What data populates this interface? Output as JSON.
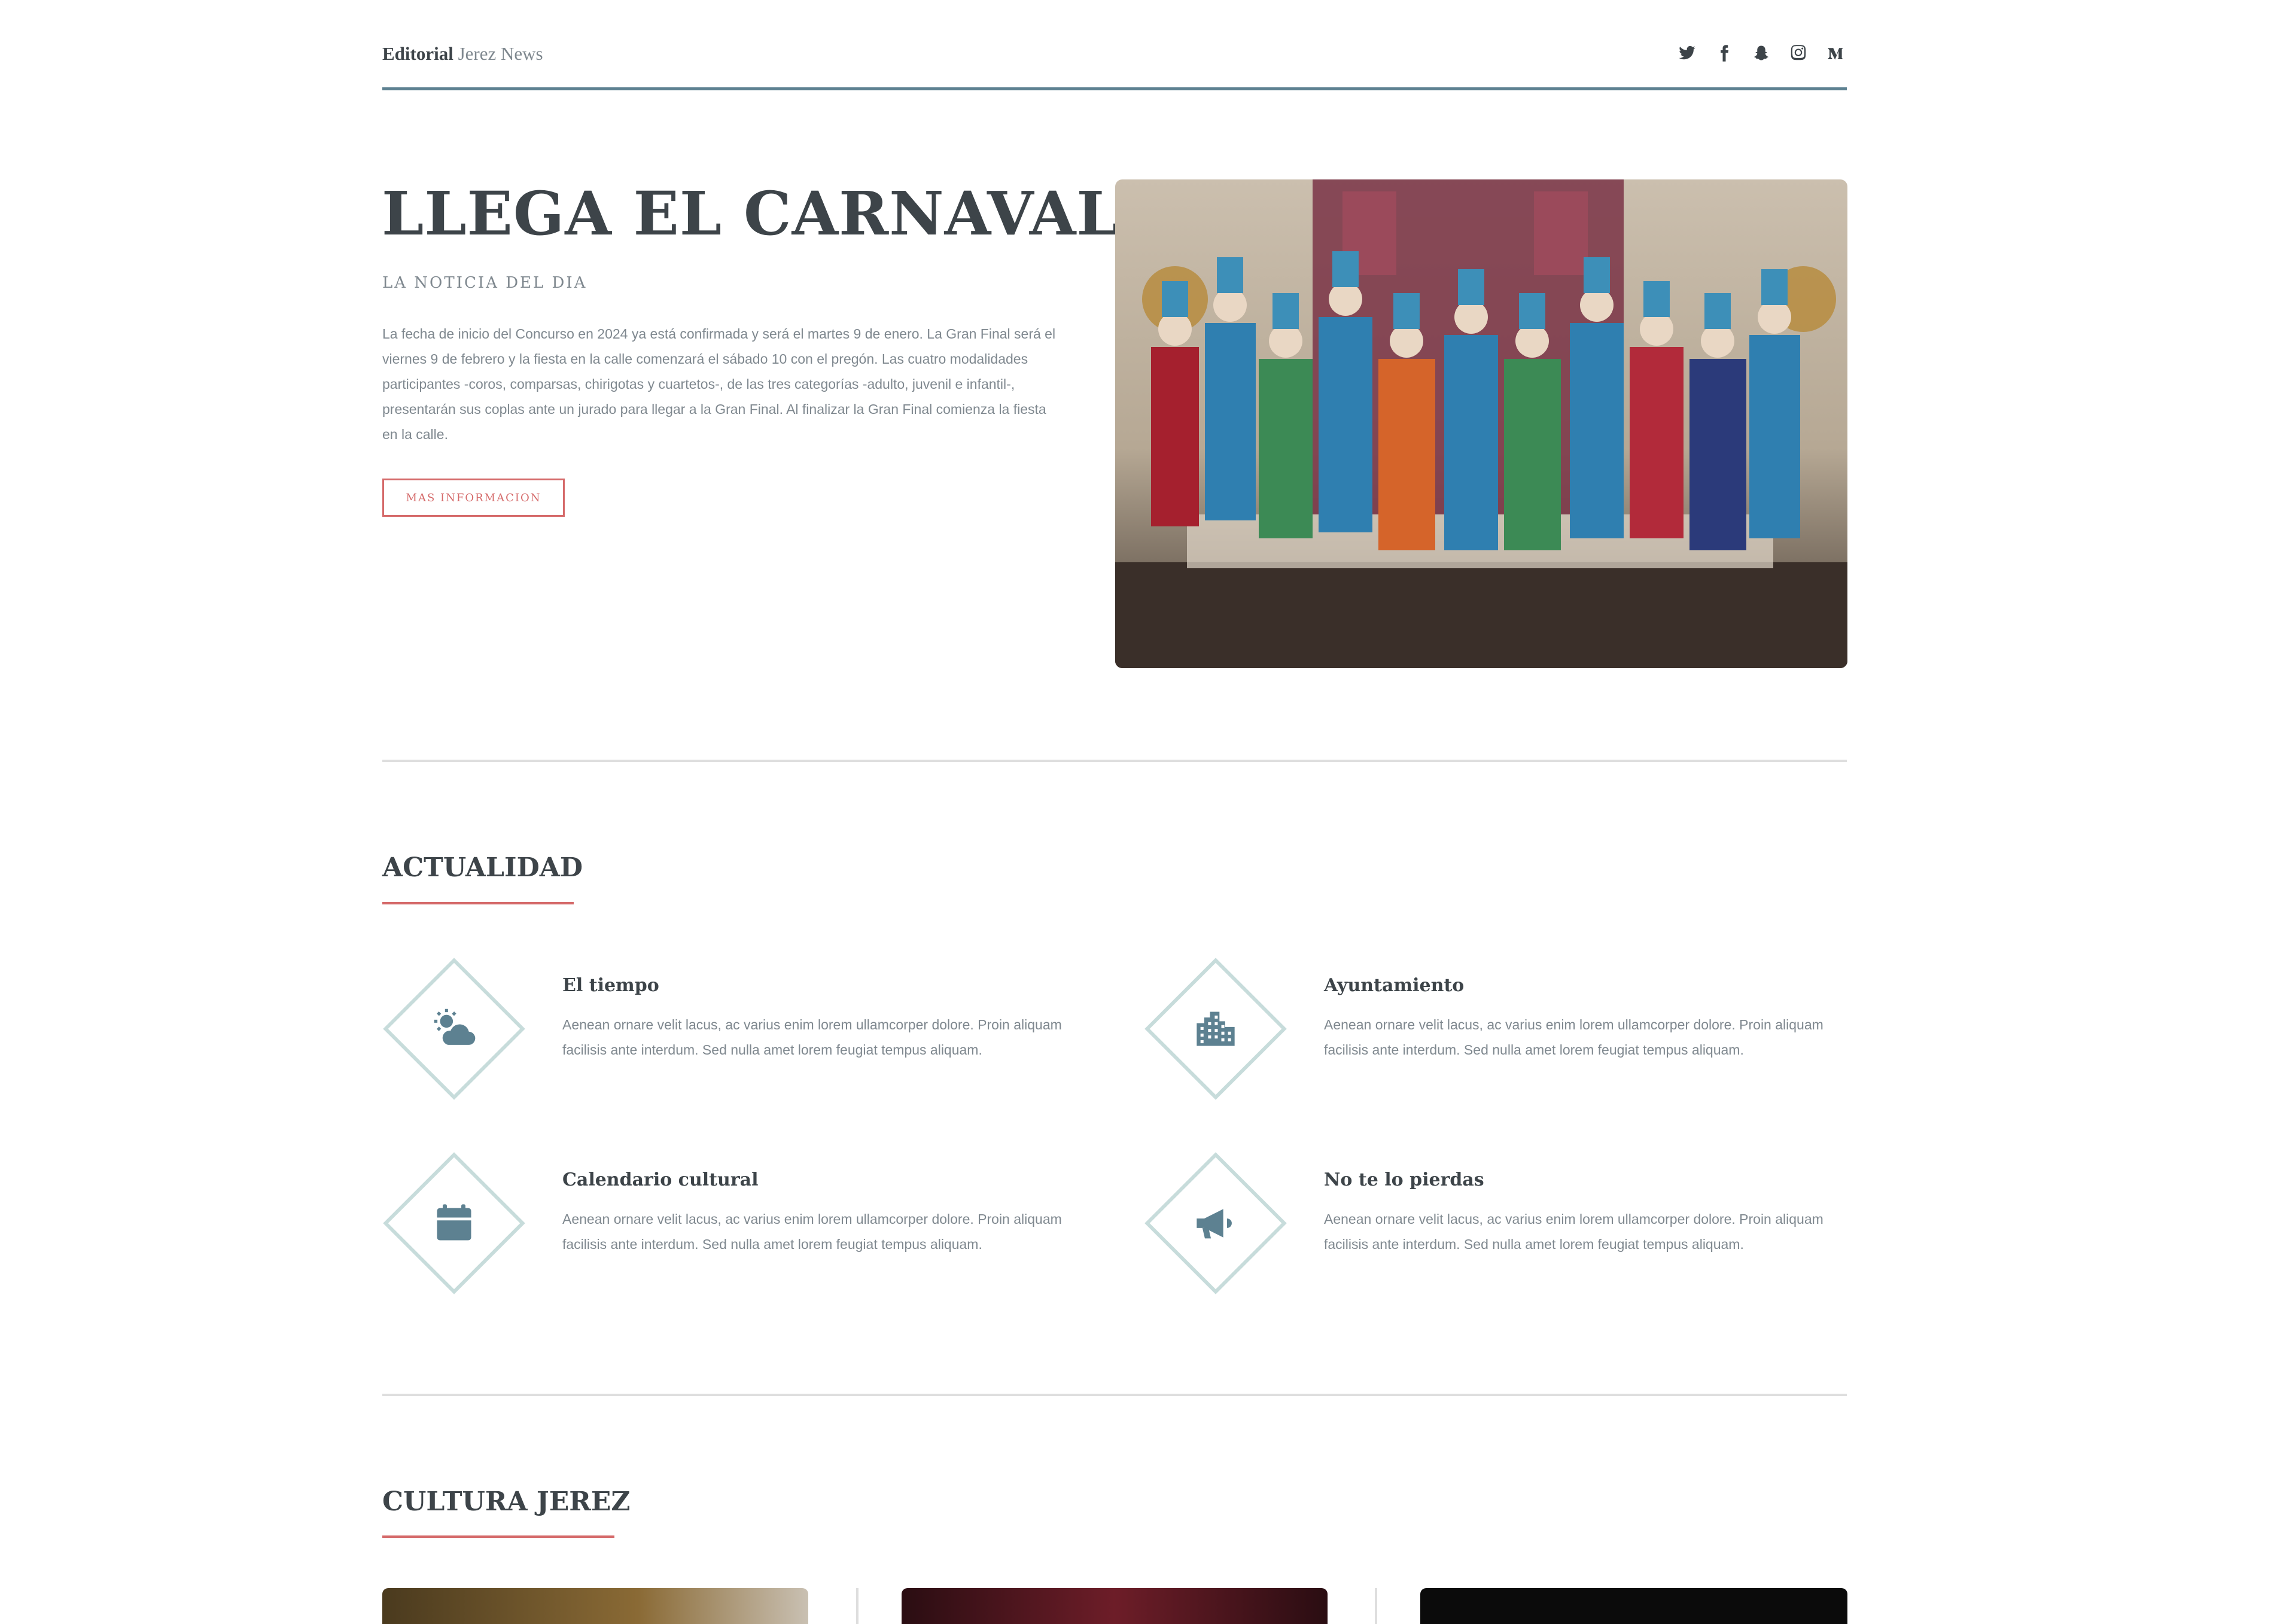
{
  "header": {
    "logo_bold": "Editorial",
    "logo_rest": "Jerez News",
    "social_icons": [
      "twitter-icon",
      "facebook-icon",
      "snapchat-icon",
      "instagram-icon",
      "medium-icon"
    ]
  },
  "banner": {
    "title": "LLEGA EL CARNAVAL",
    "subtitle": "LA NOTICIA DEL DIA",
    "text": "La fecha de inicio del Concurso en 2024 ya está confirmada y será el martes 9 de enero. La Gran Final será el viernes 9 de febrero y la fiesta en la calle comenzará el sábado 10 con el pregón. Las cuatro modalidades participantes -coros, comparsas, chirigotas y cuartetos-, de las tres categorías -adulto, juvenil e infantil-, presentarán sus coplas ante un jurado para llegar a la Gran Final. Al finalizar la Gran Final comienza la fiesta en la calle.",
    "button": "MAS INFORMACION",
    "image": "carnival-chorus-photo"
  },
  "actualidad": {
    "title": "ACTUALIDAD",
    "features": [
      {
        "icon": "weather-icon",
        "title": "El tiempo",
        "text": "Aenean ornare velit lacus, ac varius enim lorem ullamcorper dolore. Proin aliquam facilisis ante interdum. Sed nulla amet lorem feugiat tempus aliquam."
      },
      {
        "icon": "city-icon",
        "title": "Ayuntamiento",
        "text": "Aenean ornare velit lacus, ac varius enim lorem ullamcorper dolore. Proin aliquam facilisis ante interdum. Sed nulla amet lorem feugiat tempus aliquam."
      },
      {
        "icon": "calendar-icon",
        "title": "Calendario cultural",
        "text": "Aenean ornare velit lacus, ac varius enim lorem ullamcorper dolore. Proin aliquam facilisis ante interdum. Sed nulla amet lorem feugiat tempus aliquam."
      },
      {
        "icon": "megaphone-icon",
        "title": "No te lo pierdas",
        "text": "Aenean ornare velit lacus, ac varius enim lorem ullamcorper dolore. Proin aliquam facilisis ante interdum. Sed nulla amet lorem feugiat tempus aliquam."
      }
    ]
  },
  "cultura": {
    "title": "CULTURA JEREZ"
  }
}
